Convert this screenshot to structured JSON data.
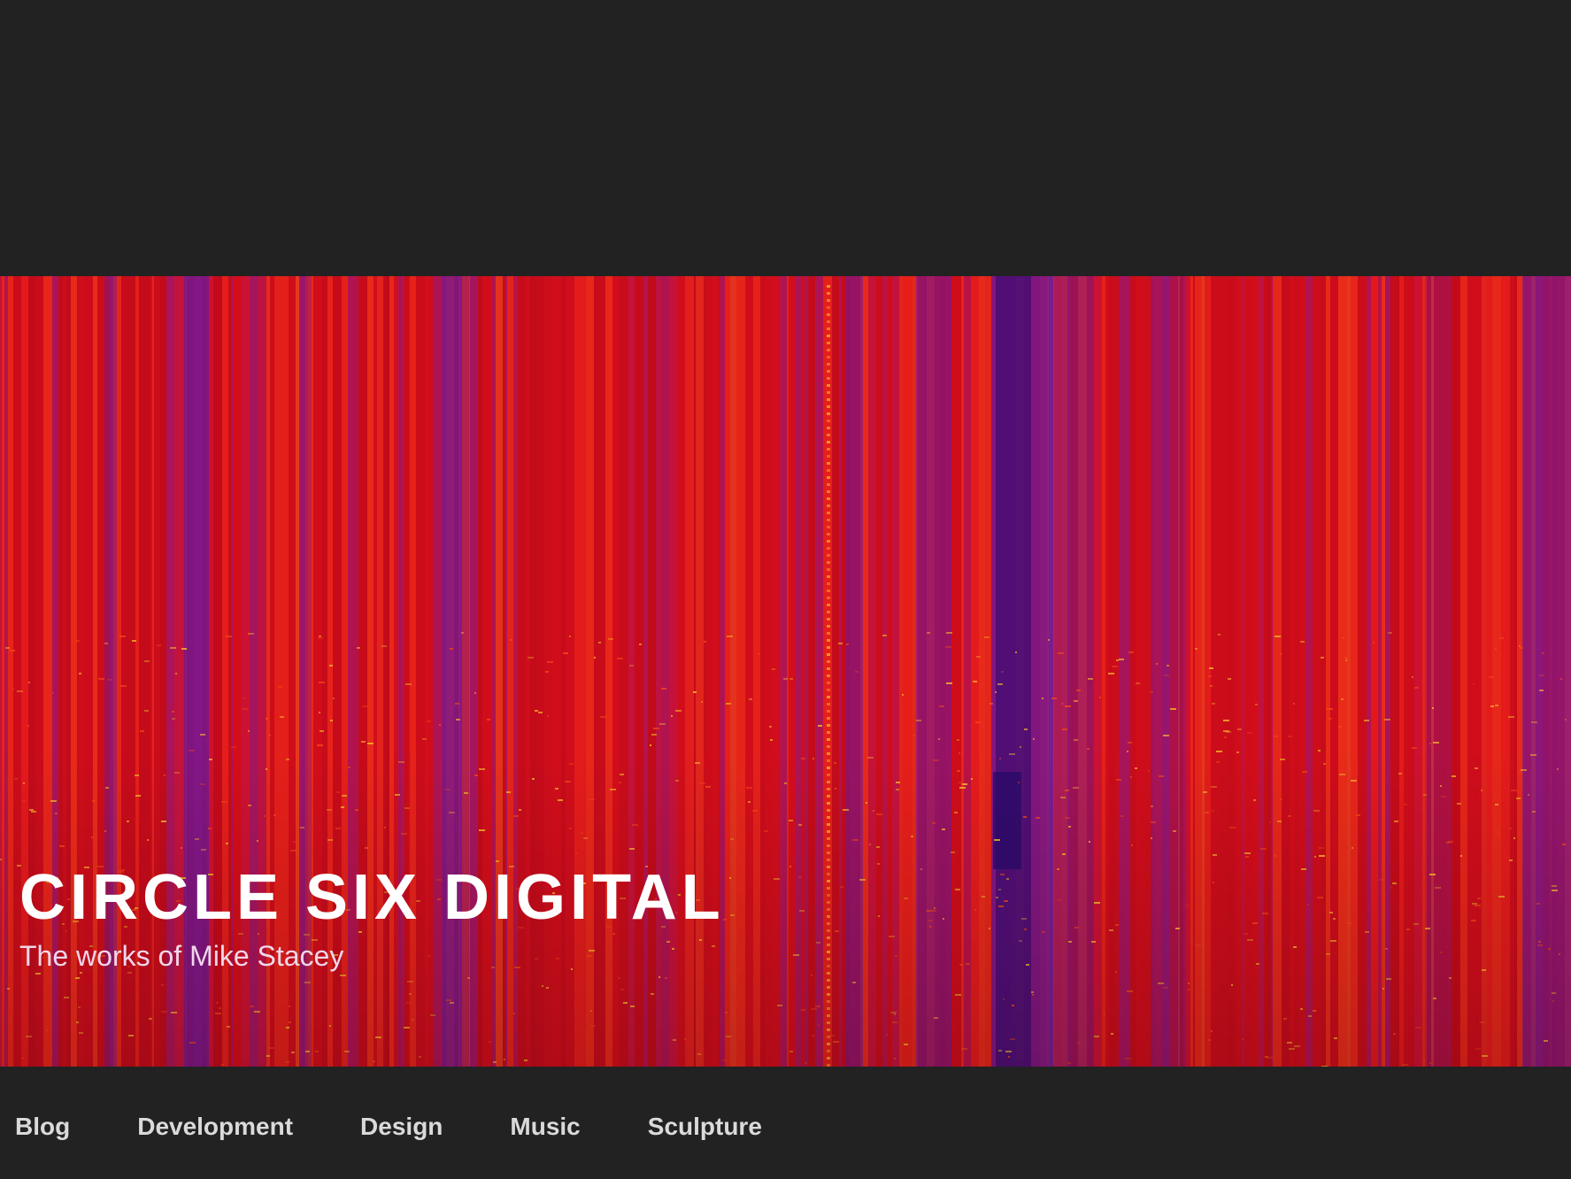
{
  "header": {
    "site_title": "CIRCLE SIX DIGITAL",
    "site_description": "The works of Mike Stacey"
  },
  "hero": {
    "image_description": "",
    "palette": {
      "base": "#e0101c",
      "deep_red": "#b0081a",
      "purple": "#6a1aa0",
      "dark_purple": "#2a0a6a",
      "orange": "#f24a18",
      "yellow": "#f7c02a"
    }
  },
  "nav": {
    "items": [
      {
        "label": "Blog"
      },
      {
        "label": "Development"
      },
      {
        "label": "Design"
      },
      {
        "label": "Music"
      },
      {
        "label": "Sculpture"
      }
    ]
  }
}
